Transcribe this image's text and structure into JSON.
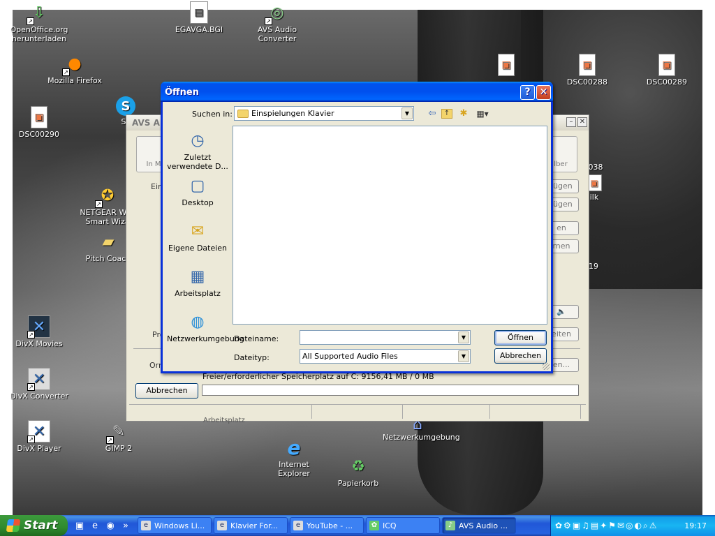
{
  "desktop": {
    "icons": [
      {
        "label": "OpenOffice.org herunterladen",
        "icon": "openoffice-download-icon",
        "glyph": "⇩"
      },
      {
        "label": "EGAVGA.BGI",
        "icon": "file-icon",
        "glyph": "▤"
      },
      {
        "label": "AVS Audio Converter",
        "icon": "avs-audio-icon",
        "glyph": "◎"
      },
      {
        "label": "Mozilla Firefox",
        "icon": "firefox-icon",
        "glyph": "●"
      },
      {
        "label": "DSC00290",
        "icon": "image-file-icon",
        "glyph": "▣"
      },
      {
        "label": "NETGEAR WG: Smart Wiza",
        "icon": "netgear-icon",
        "glyph": "✪"
      },
      {
        "label": "Pitch Coach",
        "icon": "folder-icon",
        "glyph": "▰"
      },
      {
        "label": "DivX Movies",
        "icon": "divx-movies-icon",
        "glyph": "✕"
      },
      {
        "label": "DivX Converter",
        "icon": "divx-converter-icon",
        "glyph": "✕"
      },
      {
        "label": "DivX Player",
        "icon": "divx-player-icon",
        "glyph": "✕"
      },
      {
        "label": "GIMP 2",
        "icon": "gimp-icon",
        "glyph": "✎"
      },
      {
        "label": "DSC00288",
        "icon": "image-file-icon",
        "glyph": "▣"
      },
      {
        "label": "DSC00289",
        "icon": "image-file-icon",
        "glyph": "▣"
      },
      {
        "label": "Internet Explorer",
        "icon": "internet-explorer-icon",
        "glyph": "e"
      },
      {
        "label": "Papierkorb",
        "icon": "recycle-bin-icon",
        "glyph": "♻"
      },
      {
        "label": "Netzwerkumgebung",
        "icon": "network-icon",
        "glyph": "⌂"
      },
      {
        "label": "Sk",
        "icon": "skype-icon",
        "glyph": "S"
      },
      {
        "label": "038",
        "icon": "image-file-icon",
        "glyph": ""
      },
      {
        "label": "ilk",
        "icon": "image-file-icon",
        "glyph": "▣"
      },
      {
        "label": "19",
        "icon": "image-file-icon",
        "glyph": ""
      }
    ]
  },
  "avs_window": {
    "title": "AVS A",
    "toolbar_left": "In M",
    "toolbar_right": "lber",
    "label_ein": "Ein",
    "label_pro": "Pro",
    "label_orn": "Orn",
    "side_buttons": [
      "fügen",
      "fügen",
      "en",
      "rnen",
      "eiten",
      "en..."
    ],
    "cancel_label": "Abbrechen",
    "space_text": "Freier/erforderlicher Speicherplatz auf C: 9156,41 MB / 0 MB",
    "under_text": "Arbeitsplatz"
  },
  "dialog": {
    "title": "Öffnen",
    "help": "?",
    "close": "✕",
    "lookin_label": "Suchen in:",
    "lookin_value": "Einspielungen Klavier",
    "places": [
      {
        "label": "Zuletzt verwendete D...",
        "icon": "recent-documents-icon",
        "glyph": "◷"
      },
      {
        "label": "Desktop",
        "icon": "desktop-icon",
        "glyph": "▢"
      },
      {
        "label": "Eigene Dateien",
        "icon": "my-documents-icon",
        "glyph": "✉"
      },
      {
        "label": "Arbeitsplatz",
        "icon": "my-computer-icon",
        "glyph": "▦"
      },
      {
        "label": "Netzwerkumgebung",
        "icon": "network-places-icon",
        "glyph": "◍"
      }
    ],
    "filename_label": "Dateiname:",
    "filename_value": "",
    "filetype_label": "Dateityp:",
    "filetype_value": "All Supported Audio Files",
    "open_label": "Öffnen",
    "cancel_label": "Abbrechen"
  },
  "taskbar": {
    "start_label": "Start",
    "tasks": [
      {
        "label": "Windows Li..."
      },
      {
        "label": "Klavier For..."
      },
      {
        "label": "YouTube - ..."
      },
      {
        "label": "ICQ"
      },
      {
        "label": "AVS Audio ..."
      }
    ],
    "clock": "19:17"
  }
}
